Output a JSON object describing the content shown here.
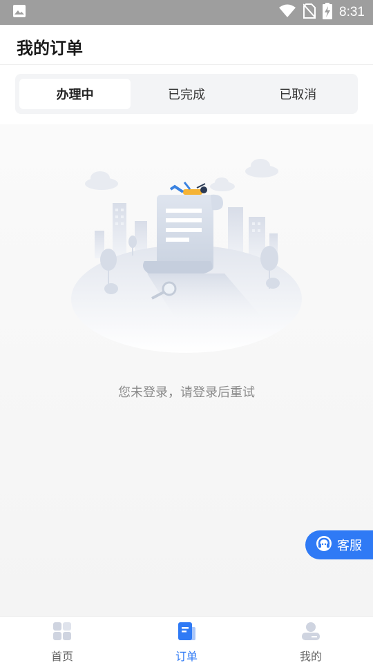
{
  "status_bar": {
    "time": "8:31",
    "icons": [
      "image-icon",
      "wifi-icon",
      "no-sim-icon",
      "battery-charging-icon"
    ]
  },
  "header": {
    "title": "我的订单"
  },
  "tabs": [
    {
      "label": "办理中",
      "active": true
    },
    {
      "label": "已完成",
      "active": false
    },
    {
      "label": "已取消",
      "active": false
    }
  ],
  "empty_state": {
    "message": "您未登录，请登录后重试",
    "illustration": "empty-order-illustration"
  },
  "service_button": {
    "label": "客服",
    "icon": "headset-icon"
  },
  "bottom_nav": [
    {
      "label": "首页",
      "icon": "home-grid-icon",
      "active": false
    },
    {
      "label": "订单",
      "icon": "order-icon",
      "active": true
    },
    {
      "label": "我的",
      "icon": "profile-icon",
      "active": false
    }
  ],
  "colors": {
    "accent": "#2f7af5",
    "status_bar": "#9e9e9e",
    "background": "#f4f4f6"
  }
}
